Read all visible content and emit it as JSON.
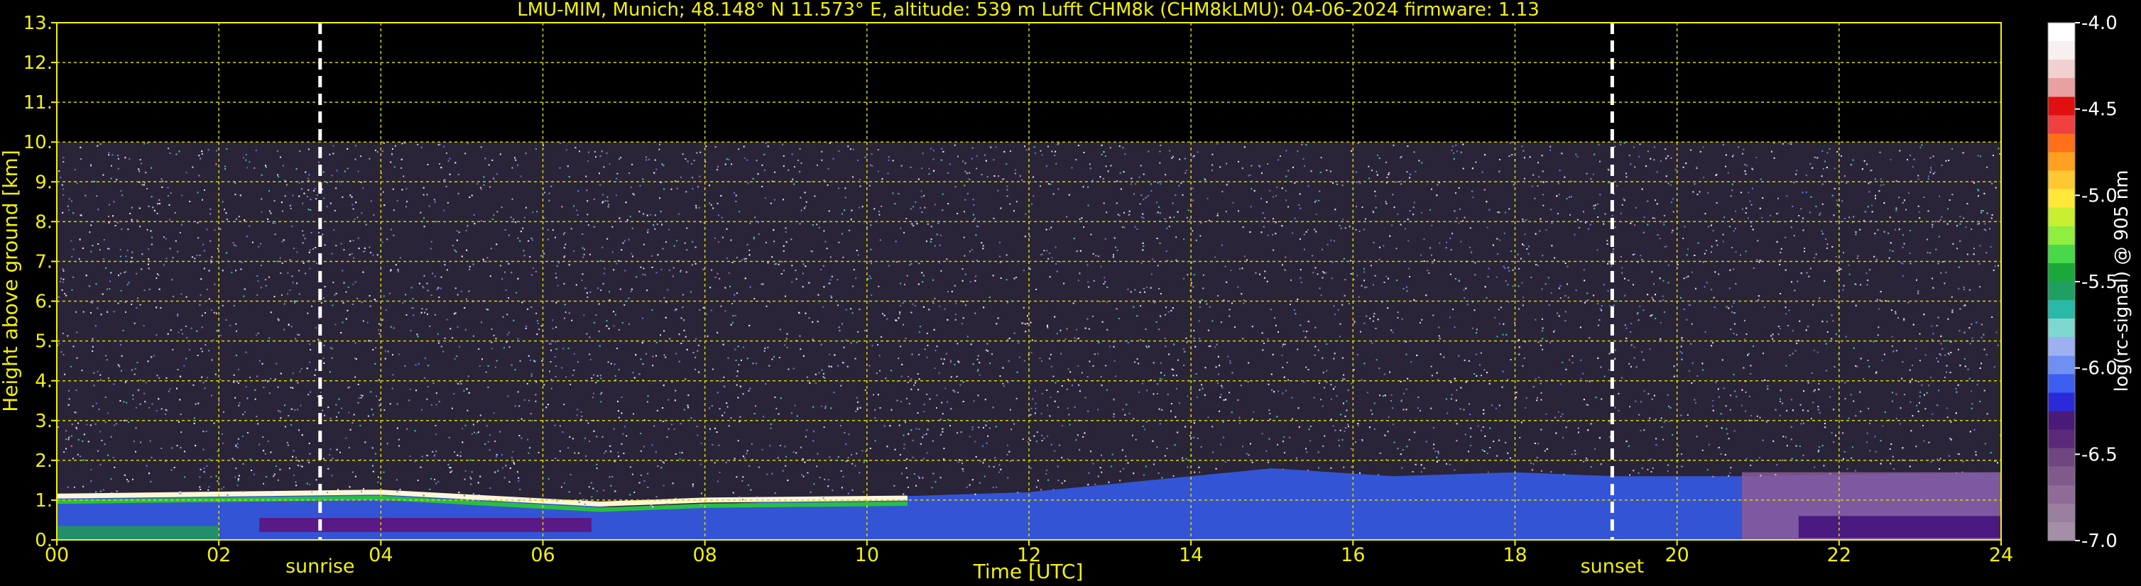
{
  "chart_data": {
    "type": "heatmap",
    "title": "LMU-MIM, Munich; 48.148° N 11.573° E, altitude: 539 m    Lufft CHM8k (CHM8kLMU): 04-06-2024    firmware: 1.13",
    "xlabel": "Time [UTC]",
    "ylabel": "Height above ground [km]",
    "xlim": [
      0,
      24
    ],
    "ylim": [
      0,
      13
    ],
    "x_ticks": [
      "00",
      "02",
      "04",
      "06",
      "08",
      "10",
      "12",
      "14",
      "16",
      "18",
      "20",
      "22",
      "24"
    ],
    "y_ticks": [
      "0.",
      "1.",
      "2.",
      "3.",
      "4.",
      "5.",
      "6.",
      "7.",
      "8.",
      "9.",
      "10.",
      "11.",
      "12.",
      "13."
    ],
    "grid": true,
    "annotations": [
      {
        "x": 3.25,
        "label": "sunrise"
      },
      {
        "x": 19.2,
        "label": "sunset"
      }
    ],
    "colorbar": {
      "label": "log(rc-signal) @ 905 nm",
      "range": [
        -7.0,
        -4.0
      ],
      "ticks": [
        "-4.0",
        "-4.5",
        "-5.0",
        "-5.5",
        "-6.0",
        "-6.5",
        "-7.0"
      ],
      "colors": [
        "#a58fa8",
        "#9b7fa0",
        "#8e6c96",
        "#7f5a8a",
        "#6f467f",
        "#5a2a78",
        "#4a1a78",
        "#2a2ad8",
        "#3c5ef0",
        "#6f8ff2",
        "#9db0f2",
        "#7fd8d0",
        "#2ab8a8",
        "#1fa060",
        "#1aa83a",
        "#48d848",
        "#90ee40",
        "#c8f030",
        "#ffe838",
        "#ffc830",
        "#ffa020",
        "#ff7018",
        "#f04040",
        "#e01010",
        "#e8a0a0",
        "#f0d0d0",
        "#f8f0f0",
        "#ffffff"
      ]
    },
    "data_top_km": 10.0,
    "cloud_base_km": [
      {
        "x": 0.0,
        "y": 1.1
      },
      {
        "x": 2.0,
        "y": 1.15
      },
      {
        "x": 4.0,
        "y": 1.2
      },
      {
        "x": 6.7,
        "y": 0.9
      },
      {
        "x": 8.0,
        "y": 1.0
      },
      {
        "x": 10.5,
        "y": 1.05
      }
    ],
    "boundary_layer_km": [
      {
        "x": 0.0,
        "y": 1.05
      },
      {
        "x": 4.0,
        "y": 1.2
      },
      {
        "x": 7.0,
        "y": 0.8
      },
      {
        "x": 10.5,
        "y": 1.1
      },
      {
        "x": 12.0,
        "y": 1.2
      },
      {
        "x": 14.0,
        "y": 1.6
      },
      {
        "x": 15.0,
        "y": 1.8
      },
      {
        "x": 16.5,
        "y": 1.6
      },
      {
        "x": 18.0,
        "y": 1.7
      },
      {
        "x": 19.2,
        "y": 1.6
      },
      {
        "x": 21.0,
        "y": 1.6
      },
      {
        "x": 24.0,
        "y": 1.7
      }
    ]
  }
}
